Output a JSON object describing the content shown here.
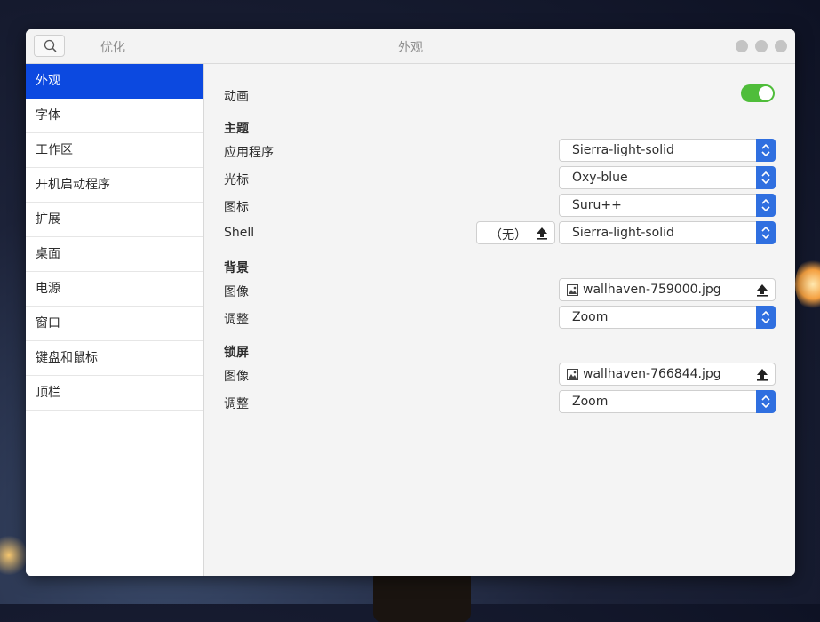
{
  "titlebar": {
    "app_title": "优化",
    "window_title": "外观"
  },
  "sidebar": {
    "items": [
      {
        "label": "外观",
        "active": true
      },
      {
        "label": "字体"
      },
      {
        "label": "工作区"
      },
      {
        "label": "开机启动程序"
      },
      {
        "label": "扩展"
      },
      {
        "label": "桌面"
      },
      {
        "label": "电源"
      },
      {
        "label": "窗口"
      },
      {
        "label": "键盘和鼠标"
      },
      {
        "label": "顶栏"
      }
    ]
  },
  "content": {
    "animation": {
      "label": "动画",
      "enabled": true
    },
    "theme": {
      "header": "主题",
      "applications": {
        "label": "应用程序",
        "value": "Sierra-light-solid"
      },
      "cursor": {
        "label": "光标",
        "value": "Oxy-blue"
      },
      "icons": {
        "label": "图标",
        "value": "Suru++"
      },
      "shell": {
        "label": "Shell",
        "file_value": "（无）",
        "value": "Sierra-light-solid"
      }
    },
    "background": {
      "header": "背景",
      "image": {
        "label": "图像",
        "value": "wallhaven-759000.jpg"
      },
      "adjust": {
        "label": "调整",
        "value": "Zoom"
      }
    },
    "lockscreen": {
      "header": "锁屏",
      "image": {
        "label": "图像",
        "value": "wallhaven-766844.jpg"
      },
      "adjust": {
        "label": "调整",
        "value": "Zoom"
      }
    }
  },
  "colors": {
    "accent": "#0c49e0",
    "toggle_on": "#4fbd3a",
    "combo_arrow": "#2f6fe0"
  }
}
